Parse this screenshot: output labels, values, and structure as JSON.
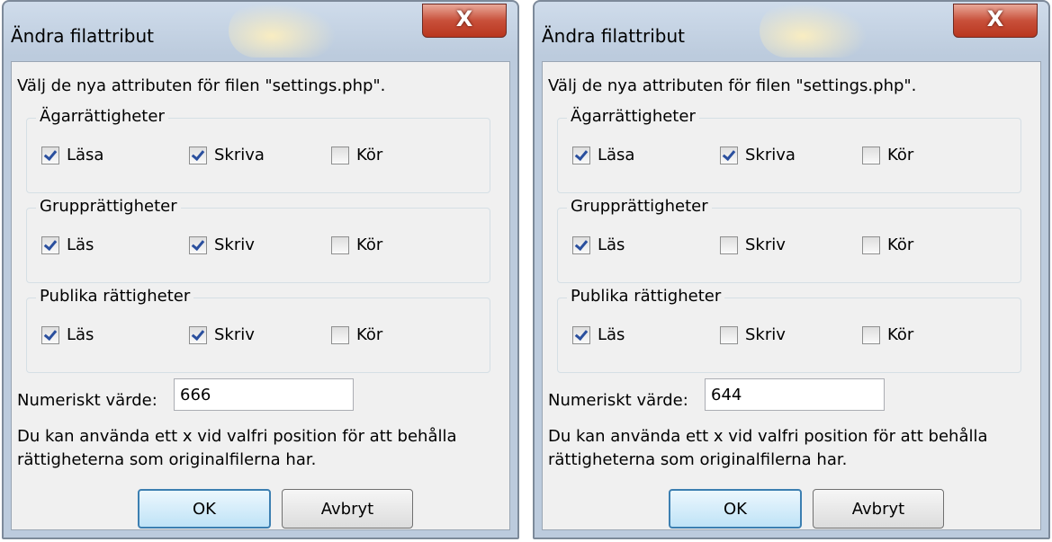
{
  "dialogs": [
    {
      "title": "Ändra filattribut",
      "close_glyph": "X",
      "prompt": "Välj de nya attributen för filen \"settings.php\".",
      "groups": [
        {
          "legend": "Ägarrättigheter",
          "options": [
            {
              "label": "Läsa",
              "checked": true
            },
            {
              "label": "Skriva",
              "checked": true
            },
            {
              "label": "Kör",
              "checked": false
            }
          ]
        },
        {
          "legend": "Grupprättigheter",
          "options": [
            {
              "label": "Läs",
              "checked": true
            },
            {
              "label": "Skriv",
              "checked": true
            },
            {
              "label": "Kör",
              "checked": false
            }
          ]
        },
        {
          "legend": "Publika rättigheter",
          "options": [
            {
              "label": "Läs",
              "checked": true
            },
            {
              "label": "Skriv",
              "checked": true
            },
            {
              "label": "Kör",
              "checked": false
            }
          ]
        }
      ],
      "numeric_label": "Numeriskt värde:",
      "numeric_value": "666",
      "hint": "Du kan använda ett x vid valfri position för att behålla rättigheterna som originalfilerna har.",
      "ok_label": "OK",
      "cancel_label": "Avbryt"
    },
    {
      "title": "Ändra filattribut",
      "close_glyph": "X",
      "prompt": "Välj de nya attributen för filen \"settings.php\".",
      "groups": [
        {
          "legend": "Ägarrättigheter",
          "options": [
            {
              "label": "Läsa",
              "checked": true
            },
            {
              "label": "Skriva",
              "checked": true
            },
            {
              "label": "Kör",
              "checked": false
            }
          ]
        },
        {
          "legend": "Grupprättigheter",
          "options": [
            {
              "label": "Läs",
              "checked": true
            },
            {
              "label": "Skriv",
              "checked": false
            },
            {
              "label": "Kör",
              "checked": false
            }
          ]
        },
        {
          "legend": "Publika rättigheter",
          "options": [
            {
              "label": "Läs",
              "checked": true
            },
            {
              "label": "Skriv",
              "checked": false
            },
            {
              "label": "Kör",
              "checked": false
            }
          ]
        }
      ],
      "numeric_label": "Numeriskt värde:",
      "numeric_value": "644",
      "hint": "Du kan använda ett x vid valfri position för att behålla rättigheterna som originalfilerna har.",
      "ok_label": "OK",
      "cancel_label": "Avbryt"
    }
  ],
  "icons": {
    "close": "close-icon"
  },
  "colors": {
    "close_button": "#c8503a",
    "ok_border": "#3c7fb1",
    "checkmark": "#2a4f9e"
  }
}
